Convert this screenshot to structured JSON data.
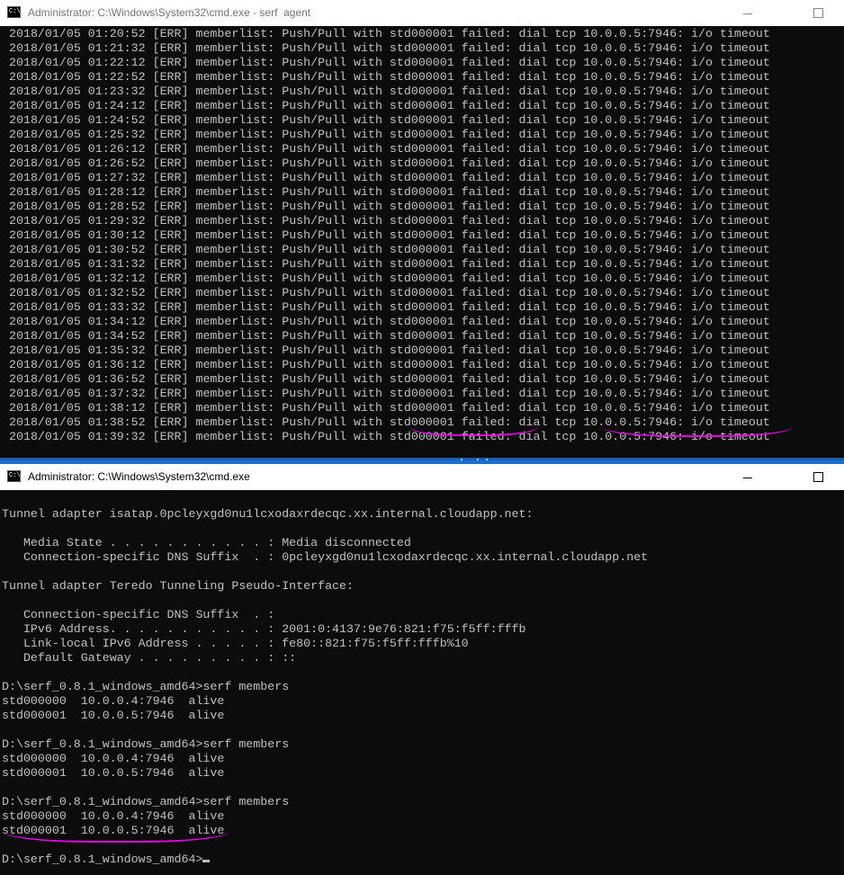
{
  "window_top": {
    "title": "Administrator: C:\\Windows\\System32\\cmd.exe - serf  agent",
    "log_lines": [
      "2018/01/05 01:20:52 [ERR] memberlist: Push/Pull with std000001 failed: dial tcp 10.0.0.5:7946: i/o timeout",
      "2018/01/05 01:21:32 [ERR] memberlist: Push/Pull with std000001 failed: dial tcp 10.0.0.5:7946: i/o timeout",
      "2018/01/05 01:22:12 [ERR] memberlist: Push/Pull with std000001 failed: dial tcp 10.0.0.5:7946: i/o timeout",
      "2018/01/05 01:22:52 [ERR] memberlist: Push/Pull with std000001 failed: dial tcp 10.0.0.5:7946: i/o timeout",
      "2018/01/05 01:23:32 [ERR] memberlist: Push/Pull with std000001 failed: dial tcp 10.0.0.5:7946: i/o timeout",
      "2018/01/05 01:24:12 [ERR] memberlist: Push/Pull with std000001 failed: dial tcp 10.0.0.5:7946: i/o timeout",
      "2018/01/05 01:24:52 [ERR] memberlist: Push/Pull with std000001 failed: dial tcp 10.0.0.5:7946: i/o timeout",
      "2018/01/05 01:25:32 [ERR] memberlist: Push/Pull with std000001 failed: dial tcp 10.0.0.5:7946: i/o timeout",
      "2018/01/05 01:26:12 [ERR] memberlist: Push/Pull with std000001 failed: dial tcp 10.0.0.5:7946: i/o timeout",
      "2018/01/05 01:26:52 [ERR] memberlist: Push/Pull with std000001 failed: dial tcp 10.0.0.5:7946: i/o timeout",
      "2018/01/05 01:27:32 [ERR] memberlist: Push/Pull with std000001 failed: dial tcp 10.0.0.5:7946: i/o timeout",
      "2018/01/05 01:28:12 [ERR] memberlist: Push/Pull with std000001 failed: dial tcp 10.0.0.5:7946: i/o timeout",
      "2018/01/05 01:28:52 [ERR] memberlist: Push/Pull with std000001 failed: dial tcp 10.0.0.5:7946: i/o timeout",
      "2018/01/05 01:29:32 [ERR] memberlist: Push/Pull with std000001 failed: dial tcp 10.0.0.5:7946: i/o timeout",
      "2018/01/05 01:30:12 [ERR] memberlist: Push/Pull with std000001 failed: dial tcp 10.0.0.5:7946: i/o timeout",
      "2018/01/05 01:30:52 [ERR] memberlist: Push/Pull with std000001 failed: dial tcp 10.0.0.5:7946: i/o timeout",
      "2018/01/05 01:31:32 [ERR] memberlist: Push/Pull with std000001 failed: dial tcp 10.0.0.5:7946: i/o timeout",
      "2018/01/05 01:32:12 [ERR] memberlist: Push/Pull with std000001 failed: dial tcp 10.0.0.5:7946: i/o timeout",
      "2018/01/05 01:32:52 [ERR] memberlist: Push/Pull with std000001 failed: dial tcp 10.0.0.5:7946: i/o timeout",
      "2018/01/05 01:33:32 [ERR] memberlist: Push/Pull with std000001 failed: dial tcp 10.0.0.5:7946: i/o timeout",
      "2018/01/05 01:34:12 [ERR] memberlist: Push/Pull with std000001 failed: dial tcp 10.0.0.5:7946: i/o timeout",
      "2018/01/05 01:34:52 [ERR] memberlist: Push/Pull with std000001 failed: dial tcp 10.0.0.5:7946: i/o timeout",
      "2018/01/05 01:35:32 [ERR] memberlist: Push/Pull with std000001 failed: dial tcp 10.0.0.5:7946: i/o timeout",
      "2018/01/05 01:36:12 [ERR] memberlist: Push/Pull with std000001 failed: dial tcp 10.0.0.5:7946: i/o timeout",
      "2018/01/05 01:36:52 [ERR] memberlist: Push/Pull with std000001 failed: dial tcp 10.0.0.5:7946: i/o timeout",
      "2018/01/05 01:37:32 [ERR] memberlist: Push/Pull with std000001 failed: dial tcp 10.0.0.5:7946: i/o timeout",
      "2018/01/05 01:38:12 [ERR] memberlist: Push/Pull with std000001 failed: dial tcp 10.0.0.5:7946: i/o timeout",
      "2018/01/05 01:38:52 [ERR] memberlist: Push/Pull with std000001 failed: dial tcp 10.0.0.5:7946: i/o timeout",
      "2018/01/05 01:39:32 [ERR] memberlist: Push/Pull with std000001 failed: dial tcp 10.0.0.5:7946: i/o timeout"
    ]
  },
  "window_bottom": {
    "title": "Administrator: C:\\Windows\\System32\\cmd.exe",
    "lines": [
      "Tunnel adapter isatap.0pcleyxgd0nu1lcxodaxrdecqc.xx.internal.cloudapp.net:",
      "",
      "   Media State . . . . . . . . . . . : Media disconnected",
      "   Connection-specific DNS Suffix  . : 0pcleyxgd0nu1lcxodaxrdecqc.xx.internal.cloudapp.net",
      "",
      "Tunnel adapter Teredo Tunneling Pseudo-Interface:",
      "",
      "   Connection-specific DNS Suffix  . :",
      "   IPv6 Address. . . . . . . . . . . : 2001:0:4137:9e76:821:f75:f5ff:fffb",
      "   Link-local IPv6 Address . . . . . : fe80::821:f75:f5ff:fffb%10",
      "   Default Gateway . . . . . . . . . : ::",
      "",
      "D:\\serf_0.8.1_windows_amd64>serf members",
      "std000000  10.0.0.4:7946  alive",
      "std000001  10.0.0.5:7946  alive",
      "",
      "D:\\serf_0.8.1_windows_amd64>serf members",
      "std000000  10.0.0.4:7946  alive",
      "std000001  10.0.0.5:7946  alive",
      "",
      "D:\\serf_0.8.1_windows_amd64>serf members",
      "std000000  10.0.0.4:7946  alive",
      "std000001  10.0.0.5:7946  alive",
      ""
    ],
    "prompt": "D:\\serf_0.8.1_windows_amd64>"
  },
  "colors": {
    "console_bg": "#0c0c0c",
    "console_text": "#c0c0c0",
    "annotation": "#e600e6",
    "taskbar_blue": "#1b5fae"
  },
  "icons": {
    "app": "cmd-console-icon",
    "minimize": "minimize-icon",
    "maximize": "maximize-icon"
  }
}
